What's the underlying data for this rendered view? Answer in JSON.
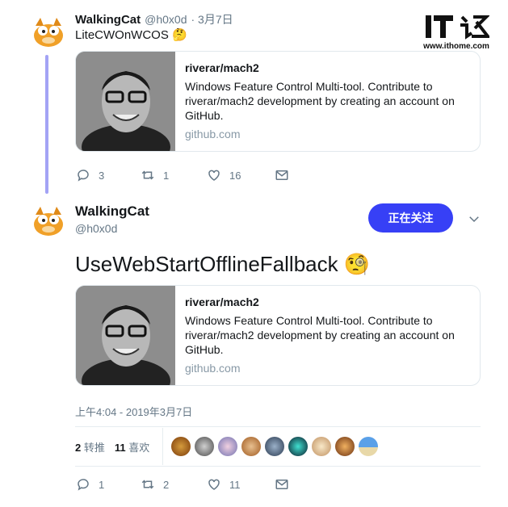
{
  "tweet1": {
    "name": "WalkingCat",
    "handle": "@h0x0d",
    "date": "· 3月7日",
    "text": "LiteCWOnWCOS 🤔",
    "card": {
      "title": "riverar/mach2",
      "description": "Windows Feature Control Multi-tool. Contribute to riverar/mach2 development by creating an account on GitHub.",
      "domain": "github.com"
    },
    "actions": {
      "replies": "3",
      "retweets": "1",
      "likes": "16"
    }
  },
  "tweet2": {
    "name": "WalkingCat",
    "handle": "@h0x0d",
    "follow_label": "正在关注",
    "text": "UseWebStartOfflineFallback 🧐",
    "card": {
      "title": "riverar/mach2",
      "description": "Windows Feature Control Multi-tool. Contribute to riverar/mach2 development by creating an account on GitHub.",
      "domain": "github.com"
    },
    "timestamp": "上午4:04 - 2019年3月7日",
    "stats": {
      "retweets_count": "2",
      "retweets_label": "转推",
      "likes_count": "11",
      "likes_label": "喜欢"
    },
    "actions": {
      "replies": "1",
      "retweets": "2",
      "likes": "11"
    }
  },
  "watermark": {
    "logo": "IT之家",
    "url": "www.ithome.com"
  },
  "colors": {
    "follow_button": "#3740f6",
    "thread_line": "#a3a3f5",
    "link_gray": "#657786"
  },
  "icons": [
    "reply-icon",
    "retweet-icon",
    "like-icon",
    "dm-icon",
    "chevron-down-icon"
  ]
}
